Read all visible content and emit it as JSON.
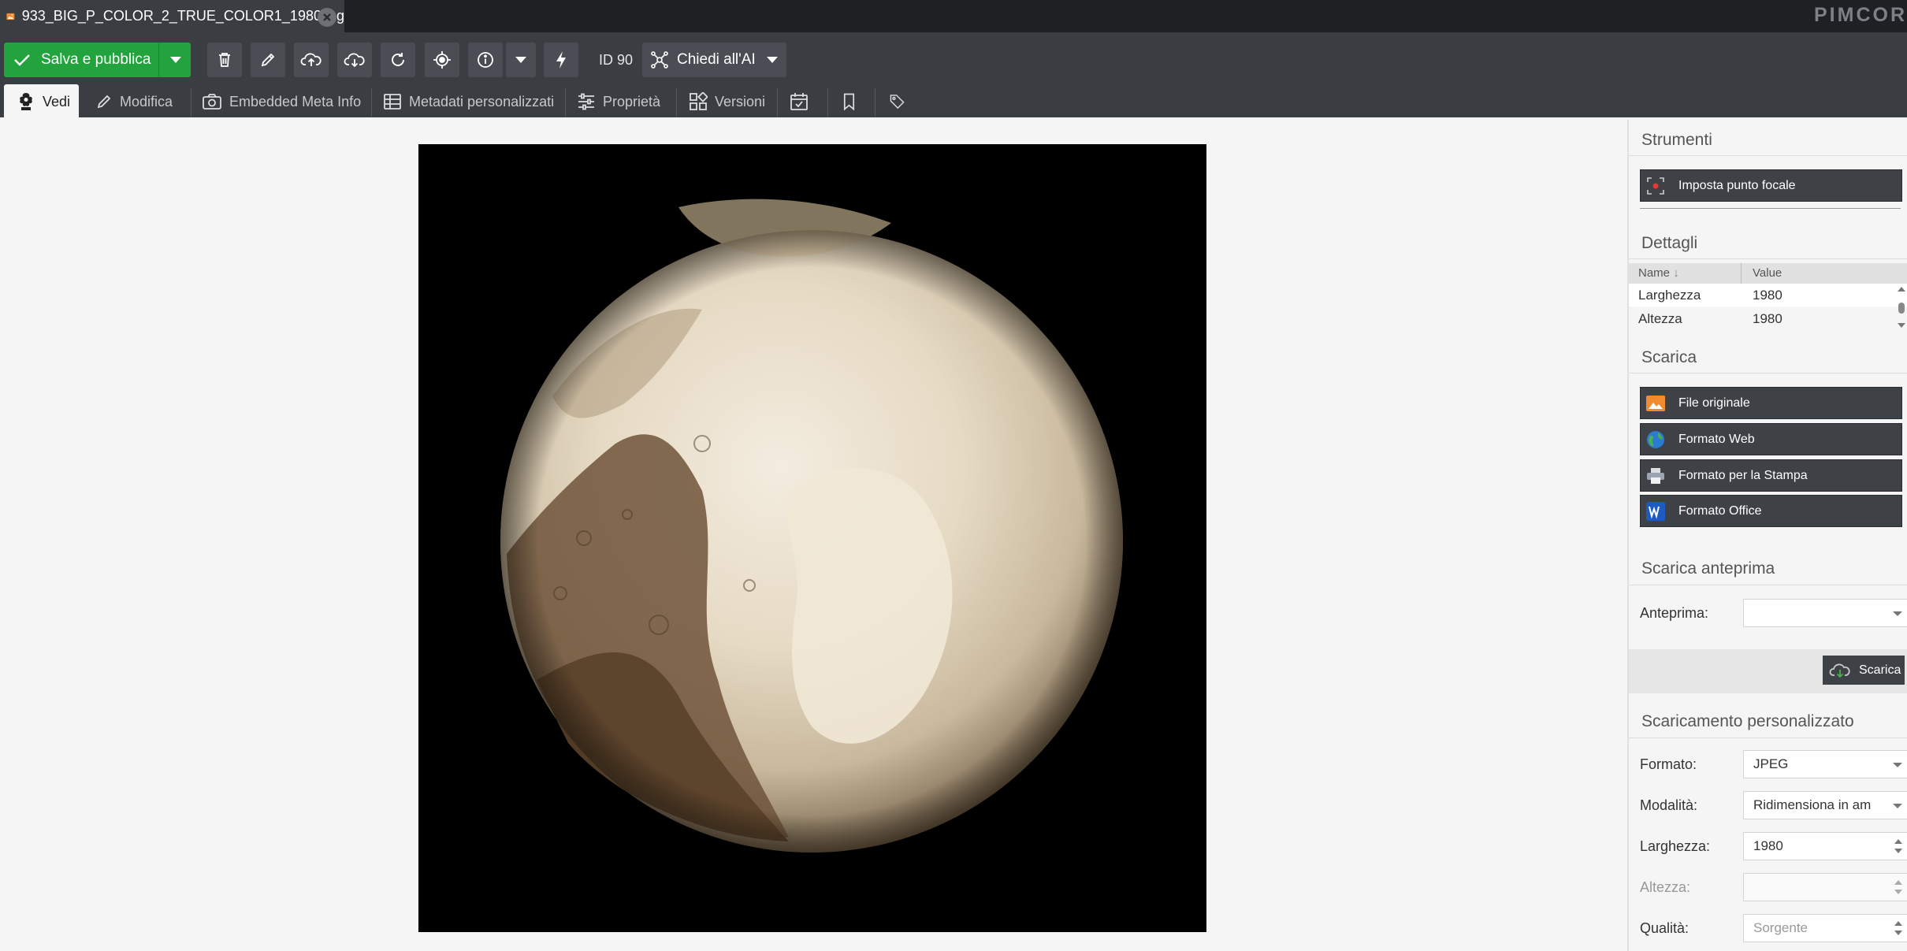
{
  "tab": {
    "title": "933_BIG_P_COLOR_2_TRUE_COLOR1_1980.jpg"
  },
  "brand": "PIMCORE",
  "toolbar": {
    "save_label": "Salva e pubblica",
    "id_label": "ID 90",
    "ai_label": "Chiedi all'AI"
  },
  "subtabs": {
    "view": "Vedi",
    "edit": "Modifica",
    "embedded": "Embedded Meta Info",
    "custom_meta": "Metadati personalizzati",
    "properties": "Proprietà",
    "versions": "Versioni"
  },
  "panel": {
    "tools_title": "Strumenti",
    "focal_point": "Imposta punto focale",
    "details_title": "Dettagli",
    "details_headers": {
      "name": "Name",
      "value": "Value"
    },
    "details_rows": [
      {
        "name": "Larghezza",
        "value": "1980"
      },
      {
        "name": "Altezza",
        "value": "1980"
      }
    ],
    "download_title": "Scarica",
    "downloads": {
      "original": "File originale",
      "web": "Formato Web",
      "print": "Formato per la Stampa",
      "office": "Formato Office"
    },
    "preview_title": "Scarica anteprima",
    "preview_label": "Anteprima:",
    "preview_value": "",
    "download_button": "Scarica",
    "custom_title": "Scaricamento personalizzato",
    "format_label": "Formato:",
    "format_value": "JPEG",
    "mode_label": "Modalità:",
    "mode_value": "Ridimensiona in am",
    "width_label": "Larghezza:",
    "width_value": "1980",
    "height_label": "Altezza:",
    "height_value": "",
    "quality_label": "Qualità:",
    "quality_value": "Sorgente"
  },
  "colors": {
    "save_green": "#22a33d",
    "toolbar_bg": "#3a3d42",
    "tabbar_bg": "#1e2024"
  }
}
